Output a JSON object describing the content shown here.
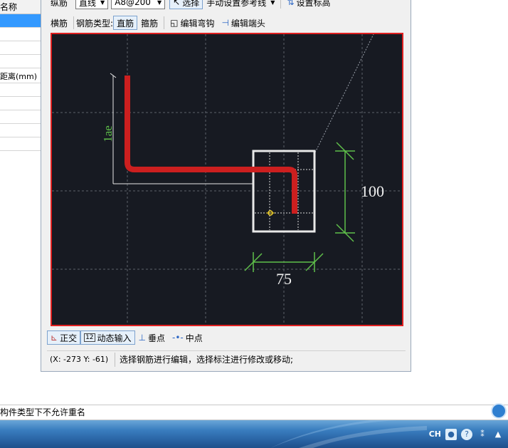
{
  "left_panel": {
    "header": "名称",
    "rows": [
      "",
      "",
      "",
      "",
      "",
      "距离(mm)",
      "",
      "",
      "",
      "",
      ""
    ]
  },
  "toolbar1": {
    "rebar_label": "纵筋",
    "line_mode": "直线",
    "spec_value": "A8@200",
    "select_label": "选择",
    "ref_line_label": "手动设置参考线",
    "elevation_label": "设置标高"
  },
  "toolbar2": {
    "horizontal": "横筋",
    "type_label": "钢筋类型:",
    "straight": "直筋",
    "stirrup": "箍筋",
    "edit_hook": "编辑弯钩",
    "edit_end": "编辑端头"
  },
  "drawing": {
    "lae_label": "1ae",
    "dim_height": "100",
    "dim_width": "75",
    "colors": {
      "rebar": "#cc1f1f",
      "dimension": "#5fbf4a",
      "section": "#e8e8e8",
      "grid": "#6a6e78"
    }
  },
  "bottom_toolbar": {
    "ortho": "正交",
    "dynamic_input": "动态输入",
    "perpendicular": "垂点",
    "midpoint": "中点"
  },
  "status": {
    "coords": "(X: -273 Y: -61)",
    "message": "选择钢筋进行编辑，选择标注进行修改或移动;"
  },
  "info_bar": {
    "text": "构件类型下不允许重名"
  },
  "tray": {
    "lang": "CH"
  }
}
